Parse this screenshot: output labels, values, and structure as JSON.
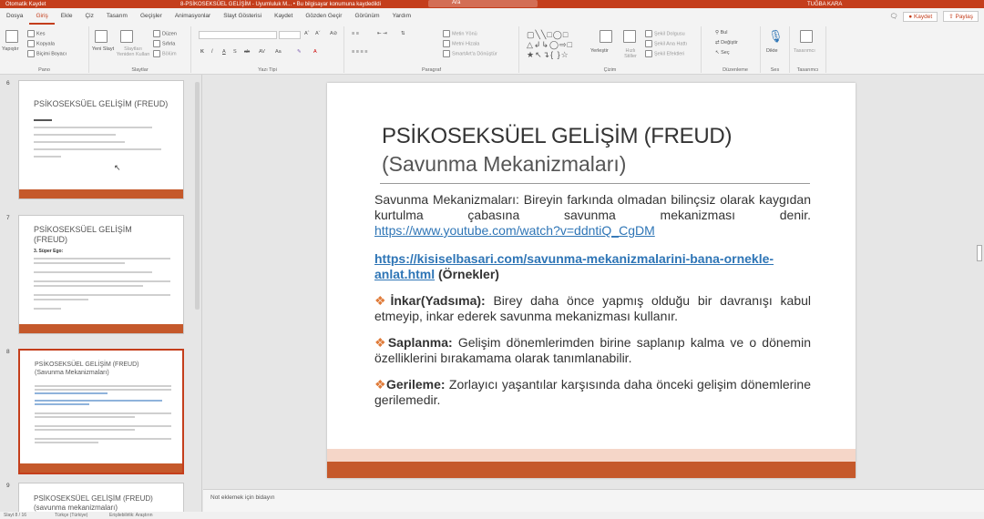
{
  "titlebar": {
    "autosave": "Otomatik Kaydet",
    "doc": "8-PSİKOSEKSÜEL GELİŞİM - Uyumluluk M... • Bu bilgisayar konumuna kaydedildi",
    "search": "Ara",
    "user": "TUĞBA KARA"
  },
  "tabs": [
    "Dosya",
    "Giriş",
    "Ekle",
    "Çiz",
    "Tasarım",
    "Geçişler",
    "Animasyonlar",
    "Slayt Gösterisi",
    "Kaydet",
    "Gözden Geçir",
    "Görünüm",
    "Yardım"
  ],
  "tabs_right": {
    "record": "Kaydet",
    "share": "Paylaş"
  },
  "ribbon": {
    "pano": {
      "label": "Pano",
      "paste": "Yapıştır",
      "cut": "Kes",
      "copy": "Kopyala",
      "format": "Biçimi Boyacı"
    },
    "slaytlar": {
      "label": "Slaytlar",
      "new": "Yeni Slayt",
      "reuse": "Slaytları Yeniden Kullan",
      "layout": "Düzen",
      "reset": "Sıfırla",
      "section": "Bölüm"
    },
    "yazitipi": {
      "label": "Yazı Tipi"
    },
    "paragraf": {
      "label": "Paragraf",
      "dir": "Metin Yönü",
      "align": "Metni Hizala",
      "smartart": "SmartArt'a Dönüştür"
    },
    "cizim": {
      "label": "Çizim",
      "arrange": "Yerleştir",
      "quick": "Hızlı Stiller",
      "fill": "Şekil Dolgusu",
      "outline": "Şekil Ana Hattı",
      "effects": "Şekil Efektleri"
    },
    "duzenleme": {
      "label": "Düzenleme",
      "find": "Bul",
      "replace": "Değiştir",
      "select": "Seç"
    },
    "ses": {
      "label": "Ses",
      "dictate": "Dikte"
    },
    "tasarimci": {
      "label": "Tasarımcı",
      "designer": "Tasarımcı"
    }
  },
  "thumbnails": [
    {
      "num": "6",
      "title": "PSİKOSEKSÜEL GELİŞİM (FREUD)"
    },
    {
      "num": "7",
      "title": "PSİKOSEKSÜEL GELİŞİM",
      "title2": "(FREUD)",
      "sub": "3. Süper Ego:"
    },
    {
      "num": "8",
      "title": "PSİKOSEKSÜEL GELİŞİM (FREUD)",
      "title2": "(Savunma Mekanizmaları)"
    },
    {
      "num": "9",
      "title": "PSİKOSEKSÜEL GELİŞİM (FREUD)",
      "title2": "(savunma mekanizmaları)"
    }
  ],
  "slide": {
    "title": "PSİKOSEKSÜEL GELİŞİM (FREUD)",
    "subtitle": "(Savunma Mekanizmaları)",
    "intro": "Savunma Mekanizmaları: Bireyin farkında olmadan bilinçsiz olarak kaygıdan kurtulma çabasına savunma mekanizması denir.",
    "link1": "https://www.youtube.com/watch?v=ddntiQ_CgDM",
    "link2": "https://kisiselbasari.com/savunma-mekanizmalarini-bana-ornekle-anlat.html",
    "link2_suffix": " (Örnekler)",
    "bullets": [
      {
        "term": "İnkar(Yadsıma):",
        "text": " Birey daha önce yapmış olduğu bir davranışı kabul etmeyip, inkar ederek savunma mekanizması kullanır."
      },
      {
        "term": "Saplanma:",
        "text": " Gelişim dönemlerimden birine saplanıp kalma ve o dönemin özelliklerini bırakamama olarak tanımlanabilir."
      },
      {
        "term": "Gerileme:",
        "text": " Zorlayıcı yaşantılar karşısında daha önceki gelişim dönemlerine gerilemedir."
      }
    ]
  },
  "notes": "Not eklemek için bidayın",
  "status": {
    "slide": "Slayt 8 / 16",
    "lang": "Türkçe (Türkiye)",
    "access": "Erişilebilirlik: Araştırın"
  }
}
